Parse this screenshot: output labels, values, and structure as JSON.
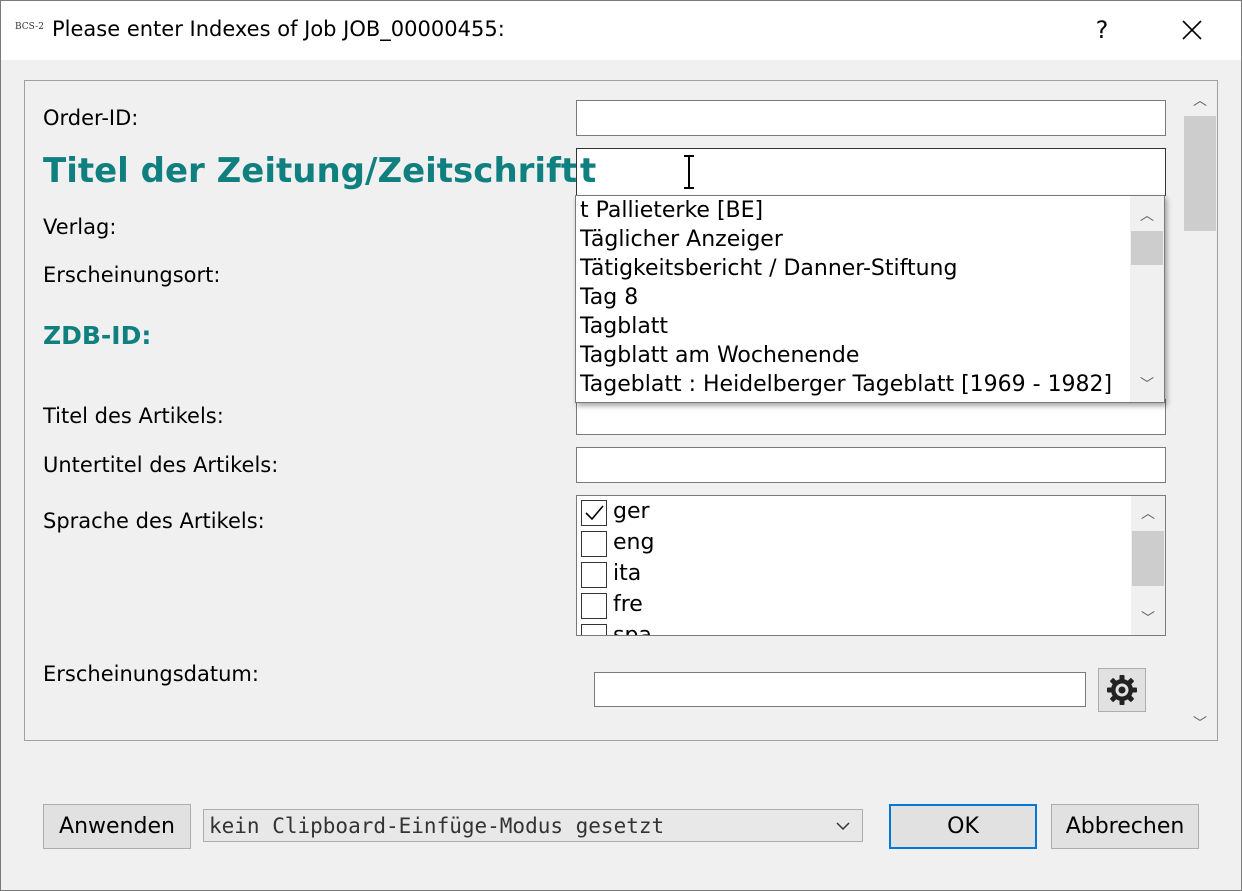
{
  "window": {
    "app_icon_text": "BCS-2",
    "title": "Please enter Indexes of Job JOB_00000455:",
    "help_label": "?"
  },
  "form": {
    "order_id_label": "Order-ID:",
    "order_id_value": "",
    "zeitung_label": "Titel der Zeitung/Zeitschrift:",
    "zeitung_value": "t",
    "verlag_label": "Verlag:",
    "erscheinungsort_label": "Erscheinungsort:",
    "zdb_label": "ZDB-ID:",
    "artikel_titel_label": "Titel des Artikels:",
    "artikel_titel_value": "",
    "untertitel_label": "Untertitel des Artikels:",
    "untertitel_value": "",
    "sprache_label": "Sprache des Artikels:",
    "datum_label": "Erscheinungsdatum:",
    "datum_value": ""
  },
  "suggestions": [
    "t Pallieterke [BE]",
    "Täglicher Anzeiger",
    "Tätigkeitsbericht / Danner-Stiftung",
    "Tag 8",
    "Tagblatt",
    "Tagblatt am Wochenende",
    "Tageblatt : Heidelberger Tageblatt [1969 - 1982]"
  ],
  "languages": [
    {
      "code": "ger",
      "checked": true
    },
    {
      "code": "eng",
      "checked": false
    },
    {
      "code": "ita",
      "checked": false
    },
    {
      "code": "fre",
      "checked": false
    },
    {
      "code": "spa",
      "checked": false
    }
  ],
  "footer": {
    "apply_label": "Anwenden",
    "clipboard_mode": "kein Clipboard-Einfüge-Modus gesetzt",
    "ok_label": "OK",
    "cancel_label": "Abbrechen"
  },
  "colors": {
    "accent_teal": "#0f7f80",
    "default_button_border": "#0078d7"
  }
}
